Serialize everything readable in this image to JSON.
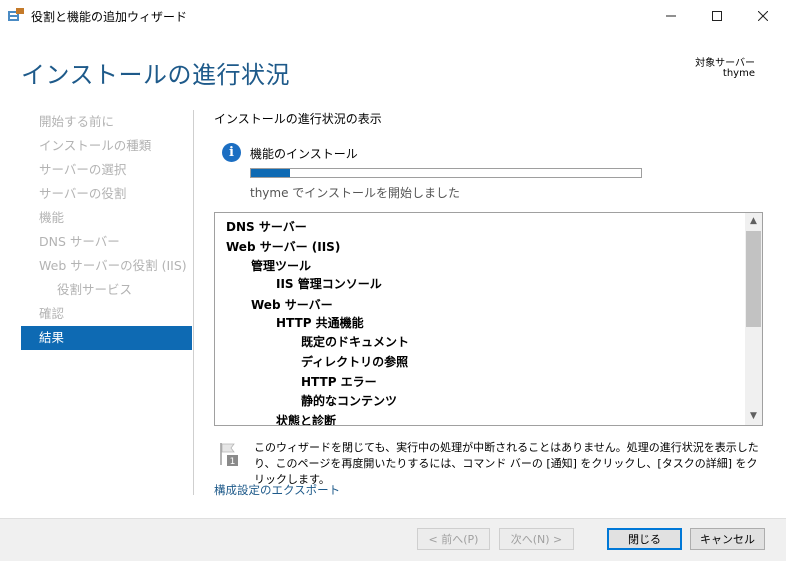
{
  "window": {
    "title": "役割と機能の追加ウィザード",
    "minimize_icon": "minimize-icon",
    "maximize_icon": "maximize-icon",
    "close_icon": "close-icon"
  },
  "header": {
    "page_title": "インストールの進行状況",
    "target_label": "対象サーバー",
    "target_value": "thyme"
  },
  "nav": {
    "items": [
      {
        "label": "開始する前に"
      },
      {
        "label": "インストールの種類"
      },
      {
        "label": "サーバーの選択"
      },
      {
        "label": "サーバーの役割"
      },
      {
        "label": "機能"
      },
      {
        "label": "DNS サーバー"
      },
      {
        "label": "Web サーバーの役割 (IIS)"
      },
      {
        "label": "役割サービス"
      },
      {
        "label": "確認"
      },
      {
        "label": "結果"
      }
    ],
    "active_index": 9
  },
  "main": {
    "section_title": "インストールの進行状況の表示",
    "info_label": "機能のインストール",
    "progress": 0.1,
    "status_text": "thyme でインストールを開始しました",
    "tree_items": [
      {
        "label": "DNS サーバー"
      },
      {
        "label": "Web サーバー (IIS)"
      },
      {
        "label": "管理ツール"
      },
      {
        "label": "IIS 管理コンソール"
      },
      {
        "label": "Web サーバー"
      },
      {
        "label": "HTTP 共通機能"
      },
      {
        "label": "既定のドキュメント"
      },
      {
        "label": "ディレクトリの参照"
      },
      {
        "label": "HTTP エラー"
      },
      {
        "label": "静的なコンテンツ"
      },
      {
        "label": "状態と診断"
      }
    ],
    "note_text": "このウィザードを閉じても、実行中の処理が中断されることはありません。処理の進行状況を表示したり、このページを再度開いたりするには、コマンド バーの [通知] をクリックし、[タスクの詳細] をクリックします。",
    "export_link": "構成設定のエクスポート"
  },
  "footer": {
    "prev_label": "< 前へ(P)",
    "next_label": "次へ(N) >",
    "close_label": "閉じる",
    "cancel_label": "キャンセル"
  }
}
